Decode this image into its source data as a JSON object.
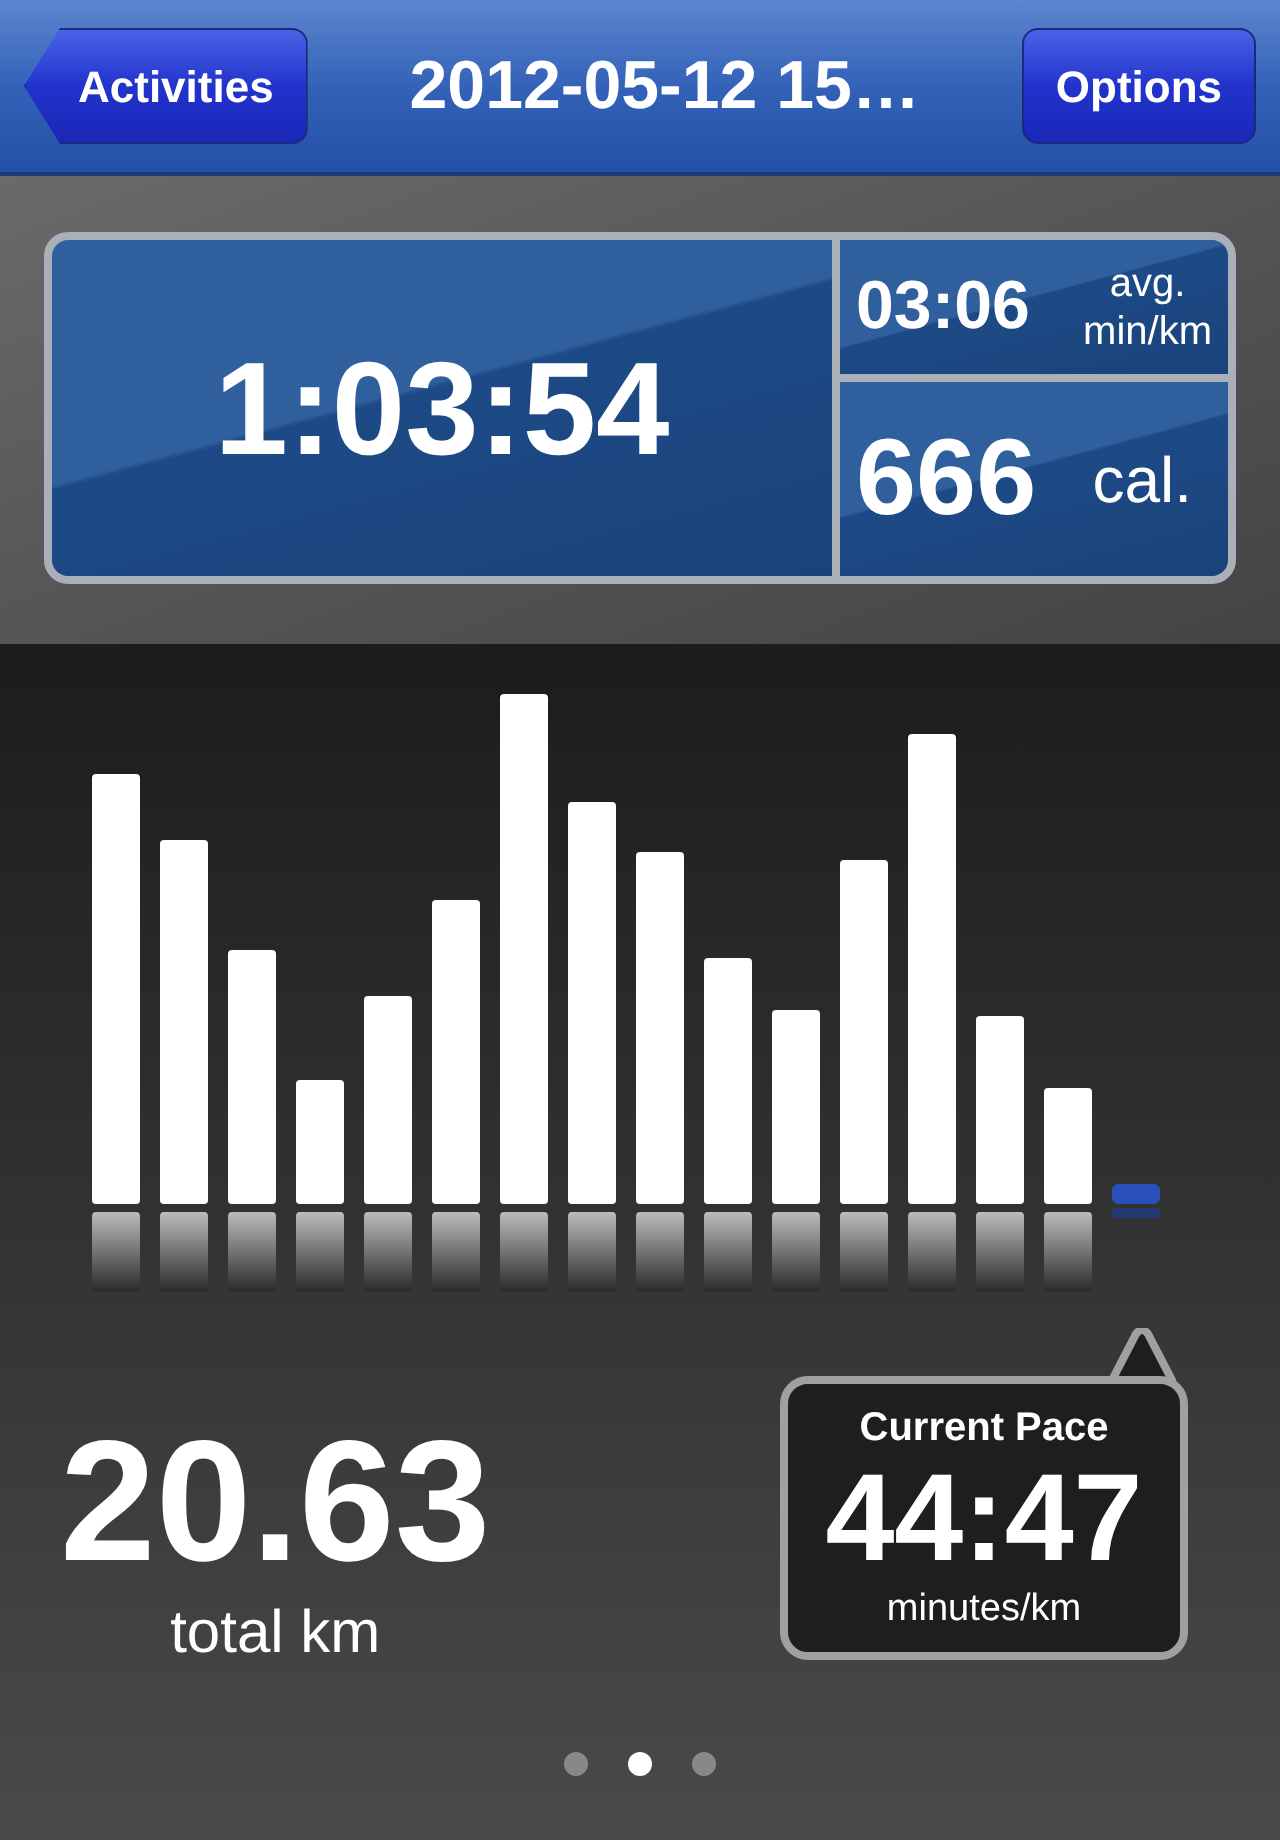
{
  "nav_bar": {
    "back_button": "Activities",
    "title": "2012-05-12 15…",
    "options_button": "Options"
  },
  "summary": {
    "duration": "1:03:54",
    "pace": {
      "value": "03:06",
      "unit_line_1": "avg.",
      "unit_line_2": "min/km"
    },
    "calories": {
      "value": "666",
      "unit": "cal."
    }
  },
  "distance": {
    "value": "20.63",
    "label": "total km"
  },
  "current_pace": {
    "title": "Current Pace",
    "value": "44:47",
    "unit": "minutes/km"
  },
  "page_dots": [
    {
      "selected": false
    },
    {
      "selected": true
    },
    {
      "selected": false
    }
  ]
}
